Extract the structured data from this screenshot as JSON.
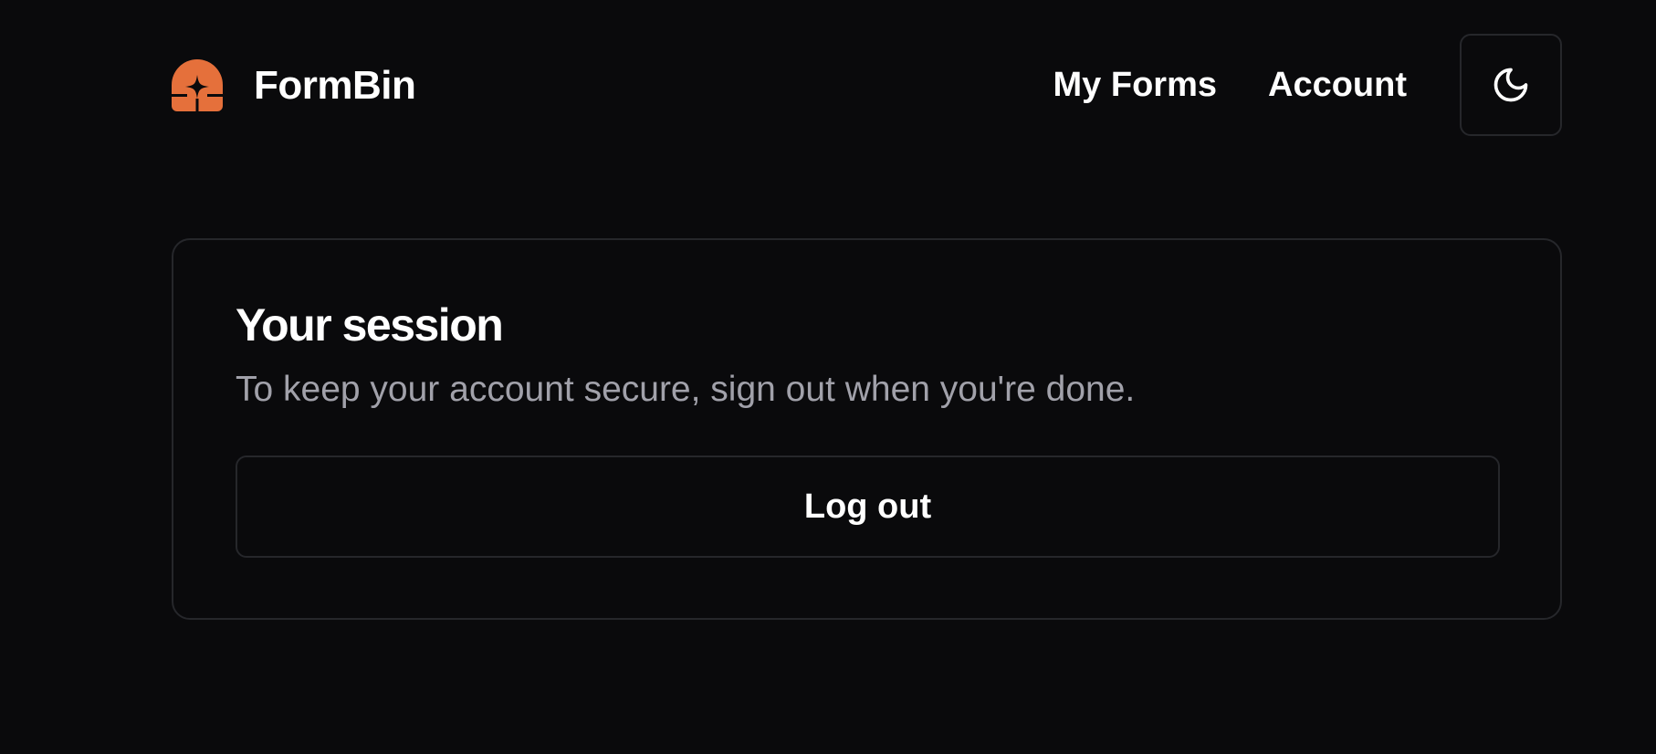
{
  "header": {
    "brand_name": "FormBin",
    "logo_icon": "formbin-logo-icon",
    "nav": [
      {
        "label": "My Forms"
      },
      {
        "label": "Account"
      }
    ],
    "theme_toggle_icon": "moon-icon"
  },
  "session_card": {
    "title": "Your session",
    "description": "To keep your account secure, sign out when you're done.",
    "logout_label": "Log out"
  },
  "colors": {
    "background": "#0a0a0c",
    "accent": "#e5703b",
    "text_primary": "#ffffff",
    "text_muted": "#a1a1aa",
    "border": "#26272b"
  }
}
